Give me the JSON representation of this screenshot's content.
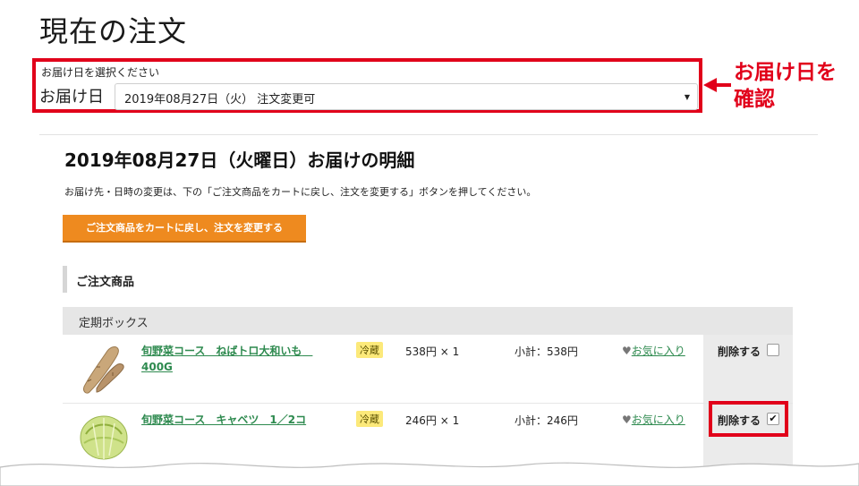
{
  "page_title": "現在の注文",
  "delivery": {
    "hint": "お届け日を選択ください",
    "label": "お届け日",
    "selected": "2019年08月27日（火） 注文変更可"
  },
  "callout": {
    "line1": "お届け日を",
    "line2": "確認"
  },
  "detail": {
    "title": "2019年08月27日（火曜日）お届けの明細",
    "note": "お届け先・日時の変更は、下の「ご注文商品をカートに戻し、注文を変更する」ボタンを押してください。",
    "return_button": "ご注文商品をカートに戻し、注文を変更する"
  },
  "section_title": "ご注文商品",
  "group_label": "定期ボックス",
  "items": [
    {
      "name": "旬野菜コース　ねばトロ大和いも　400G",
      "temp": "冷蔵",
      "price": "538円 × 1",
      "subtotal": "小計：538円",
      "favorite": "お気に入り",
      "delete": "削除する",
      "checked": false,
      "thumb_icon": "yam-icon"
    },
    {
      "name": "旬野菜コース　キャベツ　1／2コ",
      "temp": "冷蔵",
      "price": "246円 × 1",
      "subtotal": "小計：246円",
      "favorite": "お気に入り",
      "delete": "削除する",
      "checked": true,
      "thumb_icon": "cabbage-icon"
    }
  ],
  "colors": {
    "accent_red": "#e1001a",
    "button_orange": "#ee8a1f",
    "link_green": "#2e8a4f",
    "badge_yellow": "#fce97a"
  }
}
